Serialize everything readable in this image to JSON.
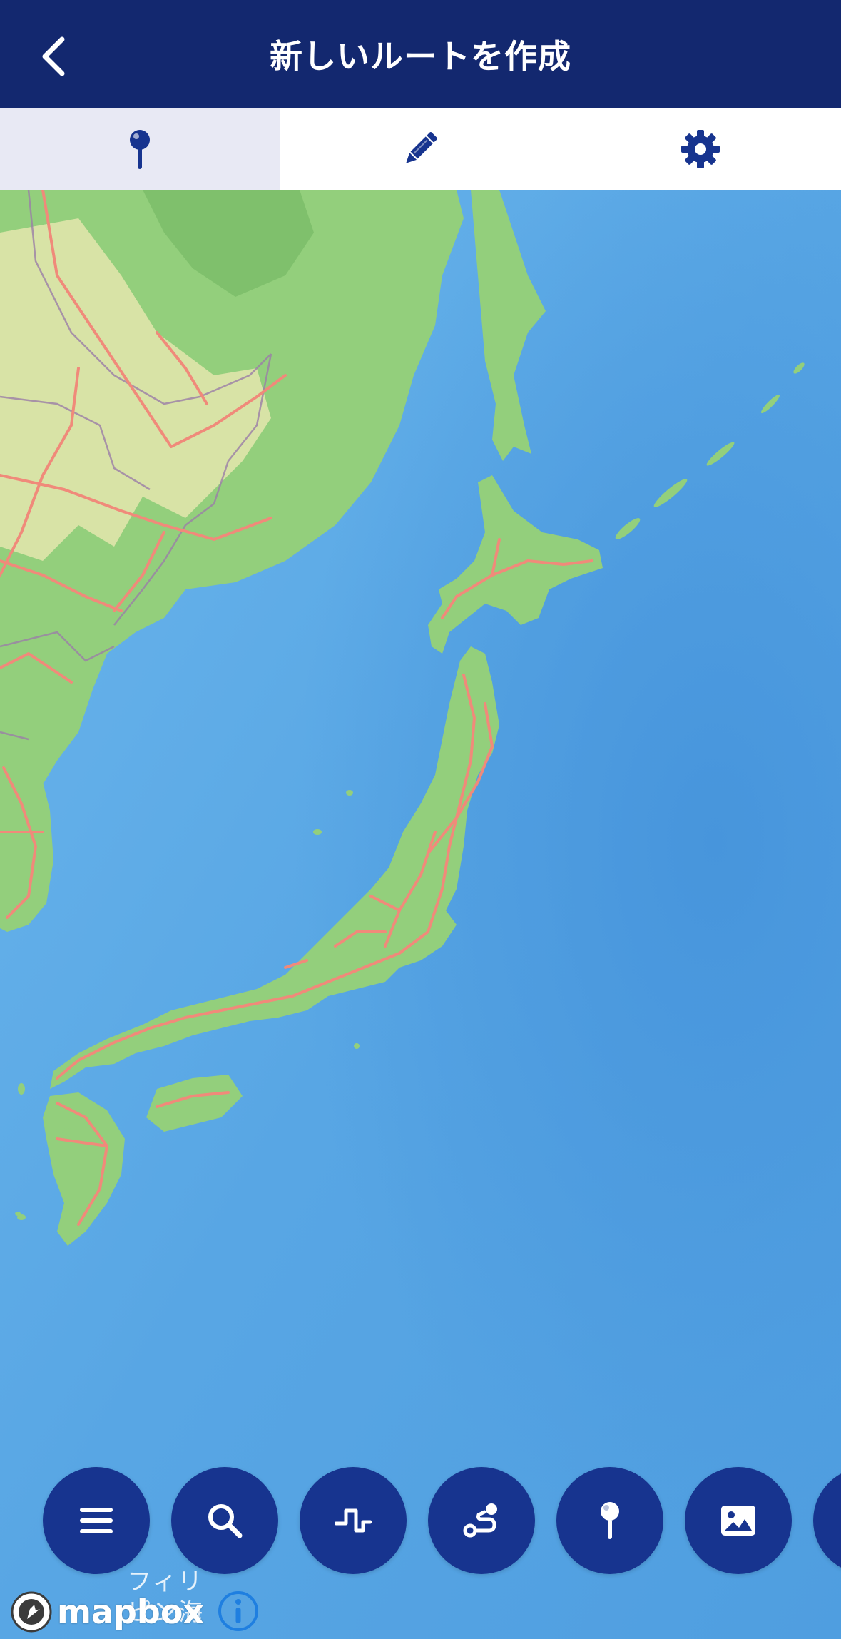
{
  "header": {
    "title": "新しいルートを作成",
    "back_icon": "chevron-left-icon"
  },
  "tabs": [
    {
      "icon": "map-pin-icon",
      "active": true
    },
    {
      "icon": "pencil-icon",
      "active": false
    },
    {
      "icon": "gear-icon",
      "active": false
    }
  ],
  "toolbar": {
    "buttons": [
      {
        "icon": "menu-icon"
      },
      {
        "icon": "search-icon"
      },
      {
        "icon": "elevation-profile-icon"
      },
      {
        "icon": "route-icon"
      },
      {
        "icon": "map-pin-icon"
      },
      {
        "icon": "image-icon"
      }
    ]
  },
  "map": {
    "labels": {
      "sea_label_line1": "フィリ",
      "sea_label_line2": "ピン海"
    }
  },
  "attribution": {
    "brand": "mapbox"
  },
  "colors": {
    "header_bg": "#13286f",
    "accent": "#17348f",
    "active_tab_bg": "#e8e9f4",
    "ocean": "#5aa8e6",
    "land": "#8ecf7a",
    "road": "#f08a7a"
  }
}
